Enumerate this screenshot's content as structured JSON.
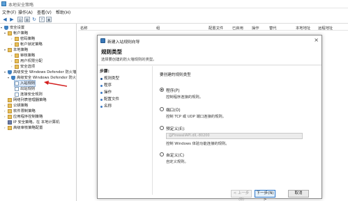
{
  "window": {
    "title": "本地安全策略"
  },
  "menu": [
    "文件(F)",
    "操作(A)",
    "查看(V)",
    "帮助(H)"
  ],
  "toolbar": {
    "icons": [
      "back-arrow-icon",
      "forward-arrow-icon",
      "folder-icon",
      "properties-icon",
      "refresh-icon",
      "help-icon",
      "help-icon"
    ]
  },
  "tree": {
    "items": [
      {
        "label": "安全设置",
        "icon": "shield"
      },
      {
        "label": "帐户策略",
        "icon": "folder"
      },
      {
        "label": "密码策略",
        "icon": "folder"
      },
      {
        "label": "帐户锁定策略",
        "icon": "folder"
      },
      {
        "label": "本地策略",
        "icon": "folder"
      },
      {
        "label": "审核策略",
        "icon": "folder"
      },
      {
        "label": "用户权限分配",
        "icon": "folder"
      },
      {
        "label": "安全选项",
        "icon": "folder"
      },
      {
        "label": "高级安全 Windows Defender 防火墙",
        "icon": "shield"
      },
      {
        "label": "高级安全 Windows Defender 防火墙",
        "icon": "shield"
      },
      {
        "label": "入站规则",
        "icon": "doc"
      },
      {
        "label": "出站规则",
        "icon": "doc"
      },
      {
        "label": "连接安全规则",
        "icon": "doc"
      },
      {
        "label": "网络列表管理器策略",
        "icon": "folder"
      },
      {
        "label": "公钥策略",
        "icon": "folder"
      },
      {
        "label": "软件限制策略",
        "icon": "folder"
      },
      {
        "label": "应用程序控制策略",
        "icon": "folder"
      },
      {
        "label": "IP 安全策略，在 本地计算机",
        "icon": "book"
      },
      {
        "label": "高级审核策略配置",
        "icon": "folder"
      }
    ]
  },
  "columns": [
    "名称",
    "组",
    "配置文件",
    "已启用",
    "操作",
    "替代",
    "本地地址",
    "远程地址"
  ],
  "dialog": {
    "title": "新建入站规则向导",
    "heading": "规则类型",
    "subtitle": "选择要创建的防火墙规则的类型。",
    "steps_header": "步骤:",
    "steps": [
      "规则类型",
      "程序",
      "操作",
      "配置文件",
      "名称"
    ],
    "question": "要创建的规则类型",
    "options": [
      {
        "label": "程序(P)",
        "desc": "控制程序连接的规则。",
        "selected": true
      },
      {
        "label": "端口(O)",
        "desc": "控制 TCP 或 UDP 端口连接的规则。",
        "selected": false
      },
      {
        "label": "预定义(E):",
        "desc": "控制 Windows 体验功能连接的规则。",
        "selected": false
      },
      {
        "label": "自定义(C)",
        "desc": "自定义规则。",
        "selected": false
      }
    ],
    "predefined_value": "@FirewallAPI.dll,-80200",
    "buttons": {
      "back": "< 上一步(B)",
      "next": "下一步(N) >",
      "cancel": "取消"
    }
  }
}
